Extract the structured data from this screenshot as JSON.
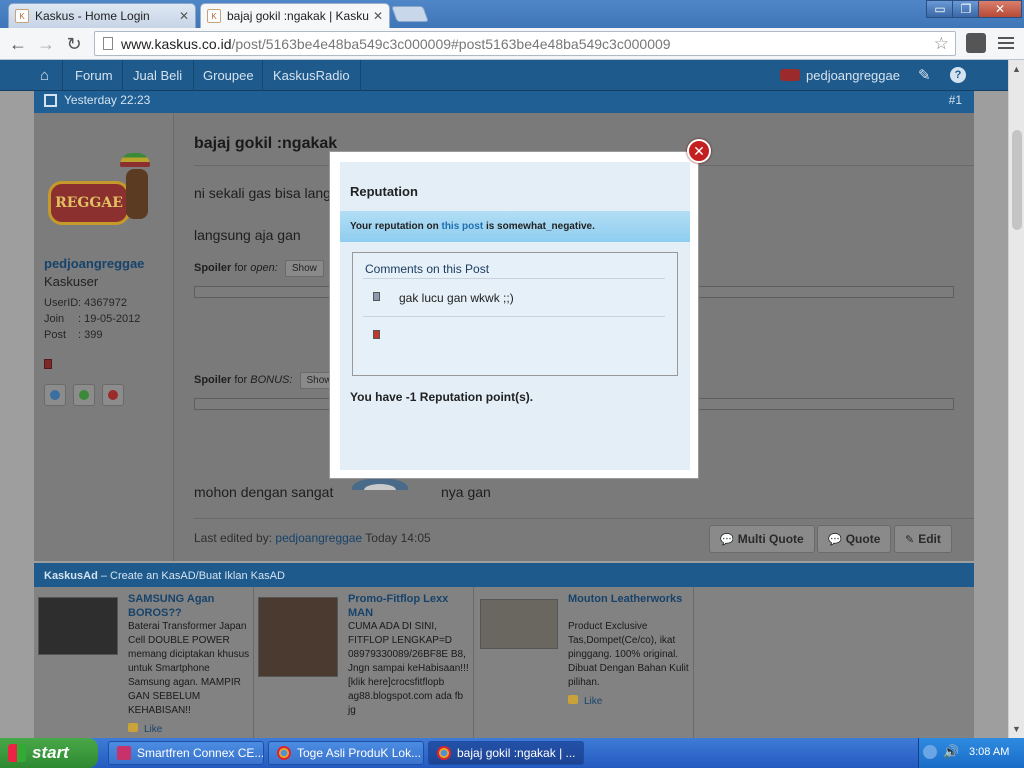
{
  "browser": {
    "tabs": [
      {
        "title": "Kaskus - Home Login",
        "active": false
      },
      {
        "title": "bajaj gokil :ngakak | Kaskus -",
        "active": true
      }
    ],
    "url": {
      "host": "www.kaskus.co.id",
      "path": "/post/5163be4e48ba549c3c000009#post5163be4e48ba549c3c000009"
    },
    "window_buttons": {
      "minimize": "▭",
      "maximize": "❐",
      "close": "✕"
    }
  },
  "site_nav": {
    "items": [
      "Forum",
      "Jual Beli",
      "Groupee",
      "KaskusRadio"
    ],
    "username": "pedjoangreggae"
  },
  "post_header": {
    "time": "Yesterday 22:23",
    "number": "#1"
  },
  "poster": {
    "avatar_text": "REGGAE",
    "username": "pedjoangreggae",
    "title": "Kaskuser",
    "fields": [
      {
        "label": "UserID",
        "value": ": 4367972"
      },
      {
        "label": "Join",
        "value": ": 19-05-2012"
      },
      {
        "label": "Post",
        "value": ": 399"
      }
    ]
  },
  "post": {
    "title": "bajaj gokil :ngakak",
    "line1": "ni sekali gas bisa lang",
    "line2": "langsung aja gan",
    "spoiler1": {
      "label": "Spoiler",
      "for": "for",
      "name": "open:",
      "button": "Show"
    },
    "spoiler2": {
      "label": "Spoiler",
      "for": "for",
      "name": "BONUS:",
      "button": "Show"
    },
    "closing_left": "mohon dengan sangat",
    "closing_right": "nya gan",
    "edited_label": "Last edited by:",
    "edited_user": "pedjoangreggae",
    "edited_time": "Today 14:05",
    "buttons": {
      "multiquote": "Multi Quote",
      "quote": "Quote",
      "edit": "Edit"
    }
  },
  "ads": {
    "header_brand": "KaskusAd",
    "header_text": "– Create an KasAD/Buat Iklan KasAD",
    "items": [
      {
        "title": "SAMSUNG Agan BOROS??",
        "desc": "Baterai Transformer Japan Cell DOUBLE POWER memang diciptakan khusus untuk Smartphone Samsung agan. MAMPIR GAN SEBELUM KEHABISAN!!",
        "like": "Like"
      },
      {
        "title": "Promo-Fitflop Lexx MAN",
        "desc": "CUMA ADA DI SINI, FITFLOP LENGKAP=D 08979330089/26BF8E B8, Jngn sampai keHabisaan!!! [klik here]crocsfitflopb ag88.blogspot.com ada fb jg"
      },
      {
        "title": "Mouton Leatherworks",
        "desc": "Product Exclusive Tas,Dompet(Ce/co), ikat pinggang. 100% original. Dibuat Dengan Bahan Kulit pilihan.",
        "like": "Like"
      }
    ]
  },
  "modal": {
    "title": "Reputation",
    "banner_prefix": "Your reputation on",
    "banner_link": "this post",
    "banner_suffix": "is somewhat_negative.",
    "comments_title": "Comments on this Post",
    "comments": [
      {
        "text": "gak lucu gan wkwk ;;)",
        "color": "#8a9ab0"
      },
      {
        "text": "",
        "color": "#c0392b"
      }
    ],
    "points": "You have -1 Reputation point(s)."
  },
  "taskbar": {
    "start": "start",
    "tasks": [
      {
        "title": "Smartfren Connex CE...",
        "active": false
      },
      {
        "title": "Toge Asli ProduK Lok...",
        "active": false
      },
      {
        "title": "bajaj gokil :ngakak | ...",
        "active": true
      }
    ],
    "clock": "3:08 AM"
  }
}
